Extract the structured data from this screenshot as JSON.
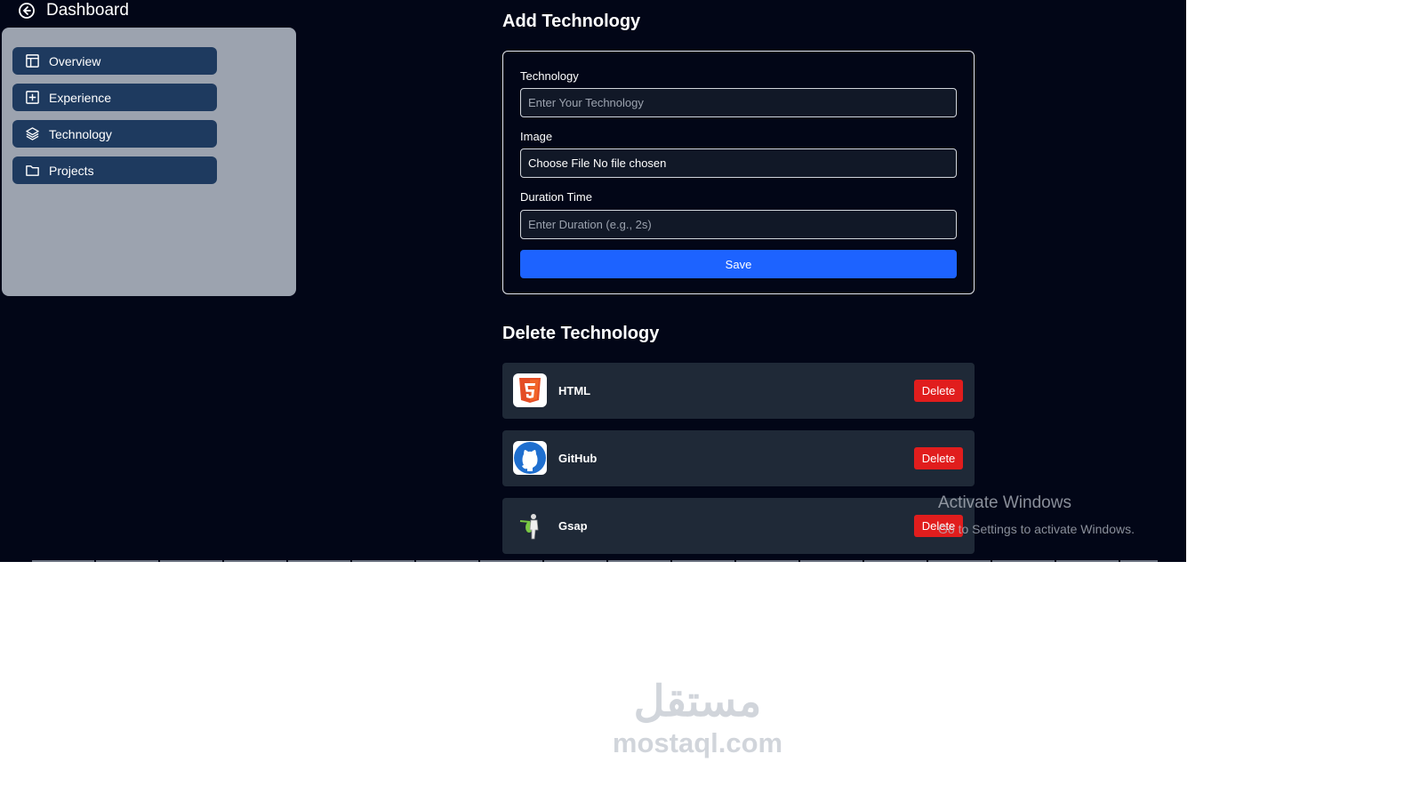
{
  "header": {
    "title": "Dashboard",
    "back_icon": "arrow-left-circle-icon"
  },
  "sidebar": {
    "items": [
      {
        "label": "Overview",
        "icon": "layout-icon"
      },
      {
        "label": "Experience",
        "icon": "plus-square-icon"
      },
      {
        "label": "Technology",
        "icon": "layers-icon"
      },
      {
        "label": "Projects",
        "icon": "folder-icon"
      }
    ]
  },
  "add_section": {
    "title": "Add Technology",
    "technology_label": "Technology",
    "technology_placeholder": "Enter Your Technology",
    "image_label": "Image",
    "file_button": "Choose File",
    "file_status": "No file chosen",
    "duration_label": "Duration Time",
    "duration_placeholder": "Enter Duration (e.g., 2s)",
    "save_label": "Save"
  },
  "delete_section": {
    "title": "Delete Technology",
    "items": [
      {
        "name": "HTML",
        "icon": "html5-icon",
        "delete_label": "Delete"
      },
      {
        "name": "GitHub",
        "icon": "github-icon",
        "delete_label": "Delete"
      },
      {
        "name": "Gsap",
        "icon": "gsap-icon",
        "delete_label": "Delete"
      }
    ]
  },
  "windows_notice": {
    "title": "Activate Windows",
    "subtitle": "Go to Settings to activate Windows."
  },
  "watermark": {
    "arabic": "مستقل",
    "latin": "mostaql.com"
  },
  "colors": {
    "background": "#020617",
    "sidebar": "#9ca3af",
    "nav_item": "#1e3a5f",
    "save": "#1d63ff",
    "delete": "#e11d1d",
    "row": "#1f2937"
  }
}
